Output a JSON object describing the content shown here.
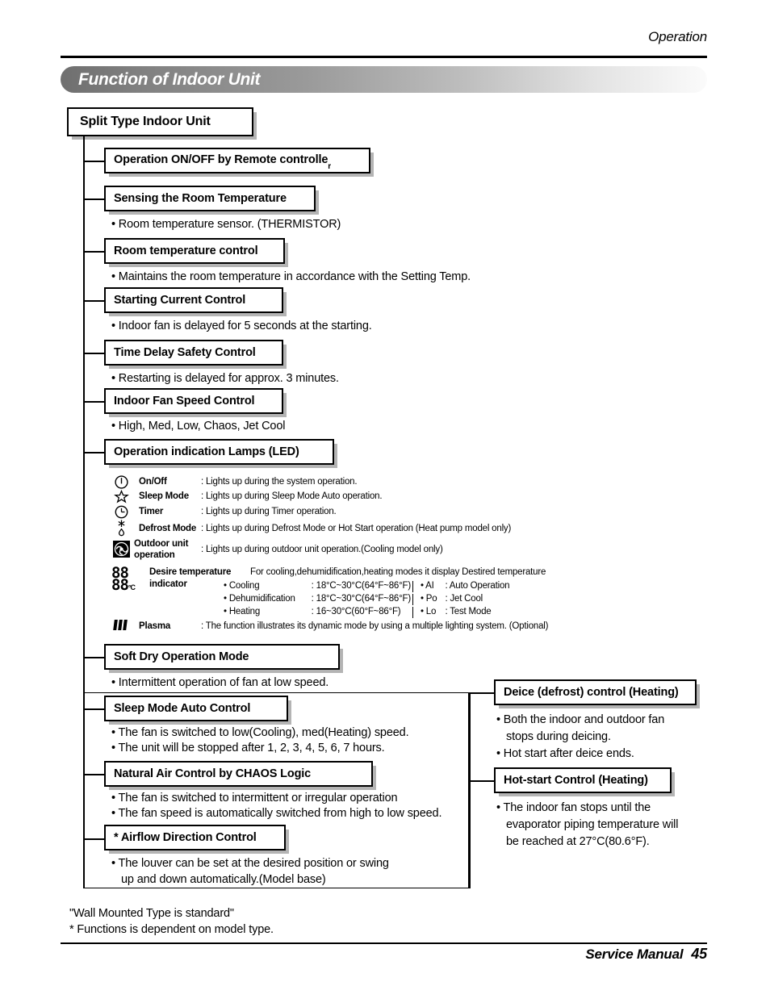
{
  "header": {
    "section": "Operation",
    "title": "Function of Indoor Unit"
  },
  "root": {
    "label": "Split Type Indoor Unit"
  },
  "nodes": [
    {
      "label": "Operation ON/OFF by Remote controlle",
      "sub": "r"
    },
    {
      "label": "Sensing the Room Temperature"
    },
    {
      "label": "Room temperature control"
    },
    {
      "label": "Starting Current Control"
    },
    {
      "label": "Time Delay Safety Control"
    },
    {
      "label": "Indoor Fan Speed Control"
    },
    {
      "label": "Operation indication Lamps (LED)"
    },
    {
      "label": "Soft Dry Operation Mode"
    },
    {
      "label": "Sleep Mode Auto Control"
    },
    {
      "label": "Natural Air Control by CHAOS Logic"
    },
    {
      "label": "* Airflow Direction Control"
    }
  ],
  "bullets": {
    "sensing": "• Room temperature sensor. (THERMISTOR)",
    "room_temp": "• Maintains the room temperature in accordance with the Setting Temp.",
    "starting_current": "• Indoor fan is delayed for 5 seconds at the starting.",
    "time_delay": "• Restarting is delayed for approx. 3 minutes.",
    "fan_speed": "• High, Med, Low, Chaos, Jet Cool",
    "soft_dry": "• Intermittent operation of fan at low speed.",
    "sleep_1": "• The fan is switched to low(Cooling), med(Heating) speed.",
    "sleep_2": "• The unit will be stopped after 1, 2, 3, 4, 5, 6, 7 hours.",
    "chaos_1": "• The fan is switched to intermittent or irregular operation",
    "chaos_2": "• The fan speed is automatically switched from high to low speed.",
    "airflow_1": "• The louver can be set at the desired position or swing",
    "airflow_2": "up and down automatically.(Model base)"
  },
  "led": {
    "rows": [
      {
        "icon": "power-icon",
        "name": "On/Off",
        "desc": ": Lights up during the system operation."
      },
      {
        "icon": "star-icon",
        "name": "Sleep Mode",
        "desc": ": Lights up during Sleep Mode Auto operation."
      },
      {
        "icon": "clock-icon",
        "name": "Timer",
        "desc": ": Lights up during Timer operation."
      },
      {
        "icon": "snowflake-drop-icon",
        "name": "Defrost Mode",
        "desc": ": Lights up during Defrost Mode or Hot Start operation (Heat pump model only)"
      },
      {
        "icon": "fan-icon",
        "name": "Outdoor unit",
        "name2": "operation",
        "desc": ": Lights up during outdoor unit operation.(Cooling model only)"
      }
    ],
    "temp": {
      "icon": "seven-segment-icon",
      "digits": "88",
      "unit": "°C",
      "name": "Desire temperature",
      "name2": "indicator",
      "desc": "For cooling,dehumidification,heating modes it display Destired temperature",
      "modes": [
        {
          "mode": "• Cooling",
          "range": ": 18°C~30°C(64°F~86°F)"
        },
        {
          "mode": "• Dehumidification",
          "range": ": 18°C~30°C(64°F~86°F)"
        },
        {
          "mode": "• Heating",
          "range": ": 16~30°C(60°F~86°F)"
        }
      ],
      "codes": [
        {
          "code": "• AI",
          "meaning": ": Auto Operation"
        },
        {
          "code": "• Po",
          "meaning": ": Jet Cool"
        },
        {
          "code": "• Lo",
          "meaning": ": Test Mode"
        }
      ]
    },
    "plasma": {
      "icon": "plasma-bars-icon",
      "name": "Plasma",
      "desc": ": The function illustrates its dynamic mode by using a multiple lighting system. (Optional)"
    }
  },
  "right_nodes": [
    {
      "label": "Deice (defrost) control (Heating)"
    },
    {
      "label": "Hot-start Control (Heating)"
    }
  ],
  "right_bullets": {
    "deice_1": "• Both the indoor and outdoor fan",
    "deice_2": "stops during deicing.",
    "deice_3": "• Hot start after deice ends.",
    "hotstart_1": "• The indoor fan stops until the",
    "hotstart_2": "evaporator piping temperature will",
    "hotstart_3": "be reached at 27°C(80.6°F)."
  },
  "notes": {
    "line1": "\"Wall Mounted Type is standard\"",
    "line2": "* Functions is dependent on model type."
  },
  "footer": {
    "label": "Service Manual",
    "page": "45"
  }
}
